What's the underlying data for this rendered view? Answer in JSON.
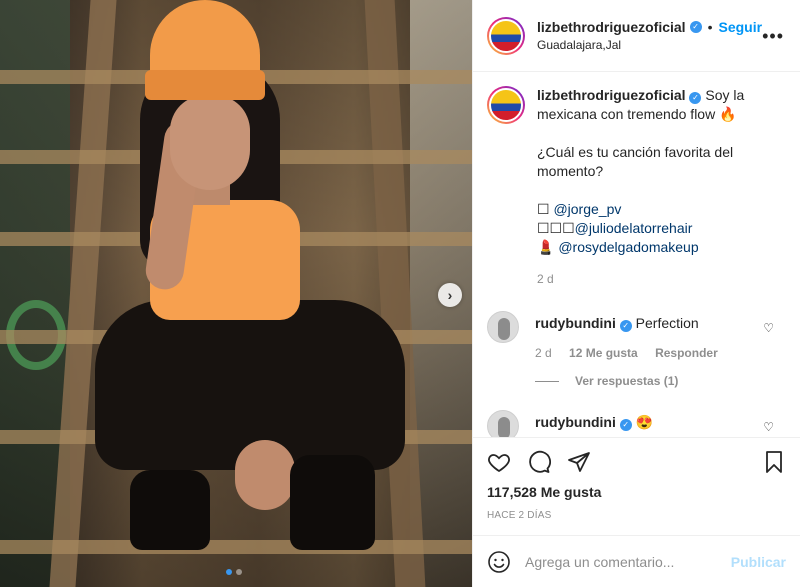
{
  "post": {
    "author": {
      "username": "lizbethrodriguezoficial",
      "location": "Guadalajara,Jal",
      "follow_label": "Seguir",
      "separator": "•"
    },
    "caption": {
      "username": "lizbethrodriguezoficial",
      "line1": "Soy la mexicana con tremendo flow 🔥",
      "line2": "¿Cuál es tu canción favorita del momento?",
      "credit1_prefix": "☐ ",
      "credit1_handle": "@jorge_pv",
      "credit2_prefix": "☐☐☐",
      "credit2_handle": "@juliodelatorrehair",
      "credit3_prefix": "💄 ",
      "credit3_handle": "@rosydelgadomakeup",
      "age": "2 d"
    },
    "comments": [
      {
        "username": "rudybundini",
        "text": "Perfection",
        "age": "2 d",
        "likes": "12 Me gusta",
        "reply_label": "Responder",
        "view_replies": "Ver respuestas (1)"
      },
      {
        "username": "rudybundini",
        "text": "😍"
      }
    ],
    "likes_count": "117,528 Me gusta",
    "date_label": "HACE 2 DÍAS",
    "comment_placeholder": "Agrega un comentario...",
    "publish_label": "Publicar",
    "carousel": {
      "total": 2,
      "active_index": 0
    }
  },
  "colors": {
    "accent": "#0095f6",
    "verified": "#3897f0",
    "publish_disabled": "#b2dffc",
    "beanie": "#f29b49",
    "top": "#f7a04f"
  },
  "icons": {
    "more": "more-options-icon",
    "like": "heart-icon",
    "comment": "comment-icon",
    "share": "paper-plane-icon",
    "save": "bookmark-icon",
    "emoji": "smiley-icon",
    "next": "chevron-right-icon"
  }
}
